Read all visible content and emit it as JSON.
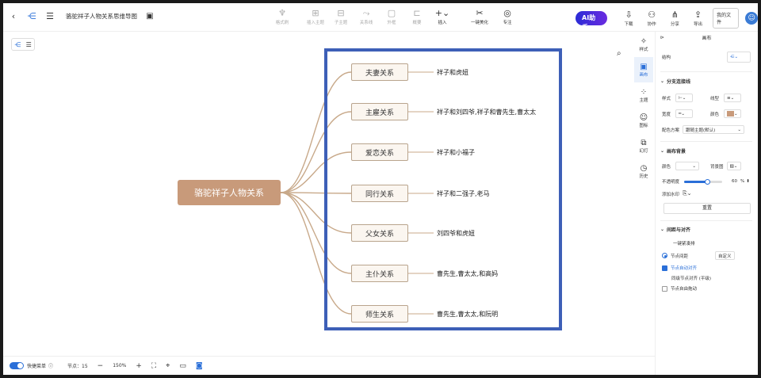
{
  "topbar": {
    "doc_title": "骆驼祥子人物关系思维导图",
    "tools": [
      {
        "label": "格式刷",
        "icon": "brush-icon"
      },
      {
        "label": "插入主题",
        "icon": "insert-topic-icon"
      },
      {
        "label": "子主题",
        "icon": "subtopic-icon"
      },
      {
        "label": "关系线",
        "icon": "relation-line-icon"
      },
      {
        "label": "外框",
        "icon": "outline-frame-icon"
      },
      {
        "label": "概要",
        "icon": "summary-icon"
      },
      {
        "label": "插入",
        "icon": "plus-icon"
      },
      {
        "label": "一键美化",
        "icon": "magic-wand-icon"
      },
      {
        "label": "专注",
        "icon": "focus-icon"
      }
    ],
    "ai_label": "AI助手",
    "right_tools": [
      {
        "label": "下载",
        "icon": "download-icon"
      },
      {
        "label": "协作",
        "icon": "collaborate-icon"
      },
      {
        "label": "分享",
        "icon": "share-icon"
      },
      {
        "label": "导出",
        "icon": "export-icon"
      }
    ],
    "my_files": "我的文件"
  },
  "mindmap": {
    "root": "骆驼祥子人物关系",
    "branches": [
      {
        "label": "夫妻关系",
        "leaf": "祥子和虎妞"
      },
      {
        "label": "主雇关系",
        "leaf": "祥子和刘四爷,祥子和曹先生,曹太太"
      },
      {
        "label": "爱恋关系",
        "leaf": "祥子和小福子"
      },
      {
        "label": "同行关系",
        "leaf": "祥子和二强子,老马"
      },
      {
        "label": "父女关系",
        "leaf": "刘四爷和虎妞"
      },
      {
        "label": "主仆关系",
        "leaf": "曹先生,曹太太,和高妈"
      },
      {
        "label": "师生关系",
        "leaf": "曹先生,曹太太,和阮明"
      }
    ],
    "link_color": "#c8a98a",
    "highlight_color": "#3d5fb7"
  },
  "iconbar": [
    {
      "label": "样式",
      "icon": "style-icon"
    },
    {
      "label": "画布",
      "icon": "canvas-icon"
    },
    {
      "label": "主题",
      "icon": "theme-icon"
    },
    {
      "label": "图标",
      "icon": "emoji-icon"
    },
    {
      "label": "幻灯",
      "icon": "slides-icon"
    },
    {
      "label": "历史",
      "icon": "history-icon"
    }
  ],
  "panel": {
    "title": "画布",
    "structure_label": "结构",
    "branch_section": "分支连接线",
    "style_label": "样式",
    "line_label": "线型",
    "width_label": "宽度",
    "color_label": "颜色",
    "color_scheme_label": "配色方案",
    "color_scheme_value": "跟随主题(默认)",
    "bg_section": "画布背景",
    "bg_color_label": "颜色",
    "bg_image_label": "背景图",
    "opacity_label": "不透明度",
    "opacity_value": "60",
    "opacity_unit": "%",
    "watermark_label": "添加水印",
    "reset_label": "重置",
    "spacing_section": "间距与对齐",
    "opt_auto": "一键紧凑排",
    "opt_node_spacing": "节点间距",
    "opt_custom": "自定义",
    "opt_align": "节点自动对齐",
    "opt_same_level": "同级节点对齐 (平级)",
    "opt_free_drag": "节点自由拖动",
    "accent": "#c89a7a"
  },
  "bottombar": {
    "toggle_label": "快捷菜单",
    "node_count": "节点：15",
    "zoom": "150%"
  }
}
